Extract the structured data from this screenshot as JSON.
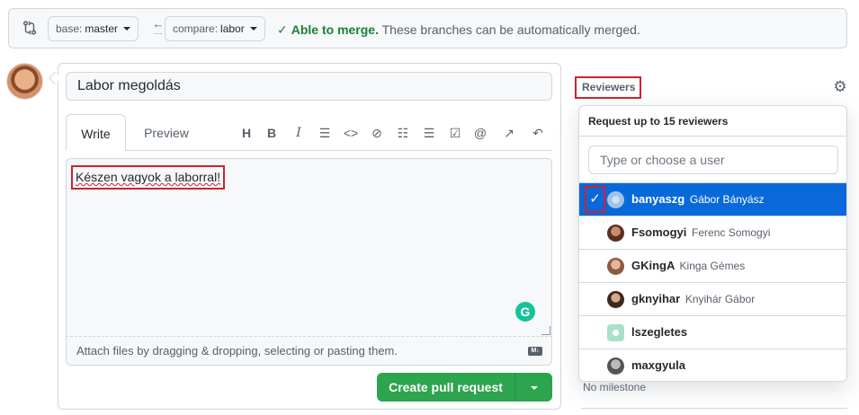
{
  "compare_bar": {
    "base_label": "base:",
    "base_value": "master",
    "compare_label": "compare:",
    "compare_value": "labor",
    "merge_status": "Able to merge.",
    "merge_detail": "These branches can be automatically merged."
  },
  "pr": {
    "title": "Labor megoldás",
    "tabs": [
      "Write",
      "Preview"
    ],
    "body": "Készen vagyok a laborral!",
    "attach_hint": "Attach files by dragging & dropping, selecting or pasting them.",
    "markdown_badge": "M↓",
    "create_button": "Create pull request"
  },
  "toolbar_icons": [
    "heading-icon",
    "bold-icon",
    "italic-icon",
    "quote-icon",
    "code-icon",
    "link-icon",
    "bulleted-list-icon",
    "numbered-list-icon",
    "task-list-icon",
    "mention-icon",
    "reference-icon",
    "undo-icon"
  ],
  "sidebar": {
    "reviewers_heading": "Reviewers",
    "no_milestone": "No milestone"
  },
  "reviewer_popup": {
    "title": "Request up to 15 reviewers",
    "filter_placeholder": "Type or choose a user",
    "users": [
      {
        "login": "banyaszg",
        "name": "Gábor Bányász",
        "selected": true
      },
      {
        "login": "Fsomogyi",
        "name": "Ferenc Somogyi",
        "selected": false
      },
      {
        "login": "GKingA",
        "name": "Kinga Gémes",
        "selected": false
      },
      {
        "login": "gknyihar",
        "name": "Knyihár Gábor",
        "selected": false
      },
      {
        "login": "lszegletes",
        "name": "",
        "selected": false
      },
      {
        "login": "maxgyula",
        "name": "",
        "selected": false
      }
    ]
  },
  "colors": {
    "success": "#1a7f37",
    "button_green": "#2da44e",
    "selected_blue": "#0969da",
    "highlight_red": "#cf222e"
  }
}
